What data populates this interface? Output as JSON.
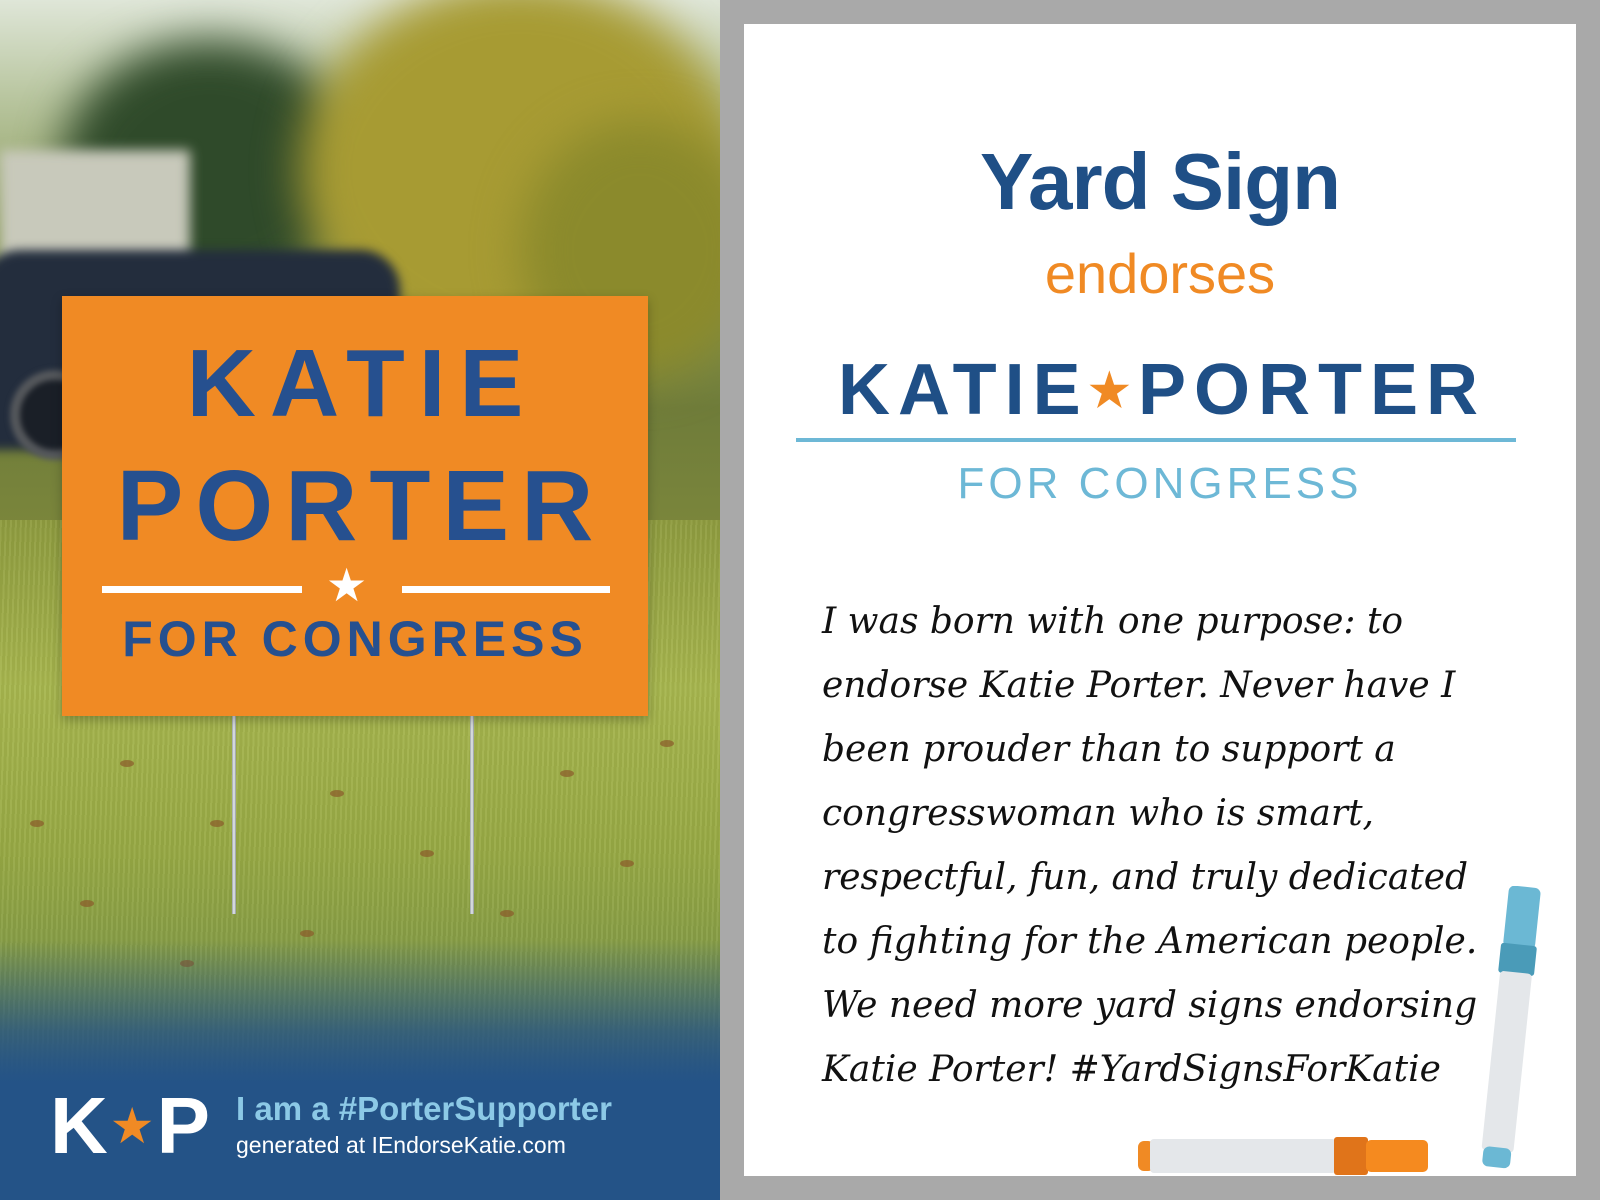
{
  "sign": {
    "line1": "KATIE",
    "line2": "PORTER",
    "star": "★",
    "line3": "FOR CONGRESS"
  },
  "footer": {
    "logo_k": "K",
    "logo_star": "★",
    "logo_p": "P",
    "tagline": "I am a #PorterSupporter",
    "generated": "generated at IEndorseKatie.com"
  },
  "card": {
    "title": "Yard Sign",
    "subtitle": "endorses",
    "name_first": "KATIE",
    "name_star": "★",
    "name_last": "PORTER",
    "office": "FOR CONGRESS",
    "quote_lines": [
      "I was born with one purpose: to",
      "endorse Katie Porter. Never have I",
      "been prouder than to support a",
      "congresswoman who is smart,",
      "respectful, fun, and truly dedicated",
      "to fighting for the American people.",
      "We need more yard signs endorsing",
      "Katie Porter! #YardSignsForKatie"
    ]
  },
  "colors": {
    "navy": "#1f4f86",
    "orange": "#f08a24",
    "light_blue": "#6db8d6",
    "footer_blue": "#245387"
  },
  "icons": [
    "star-icon",
    "orange-marker-icon",
    "blue-marker-icon"
  ]
}
